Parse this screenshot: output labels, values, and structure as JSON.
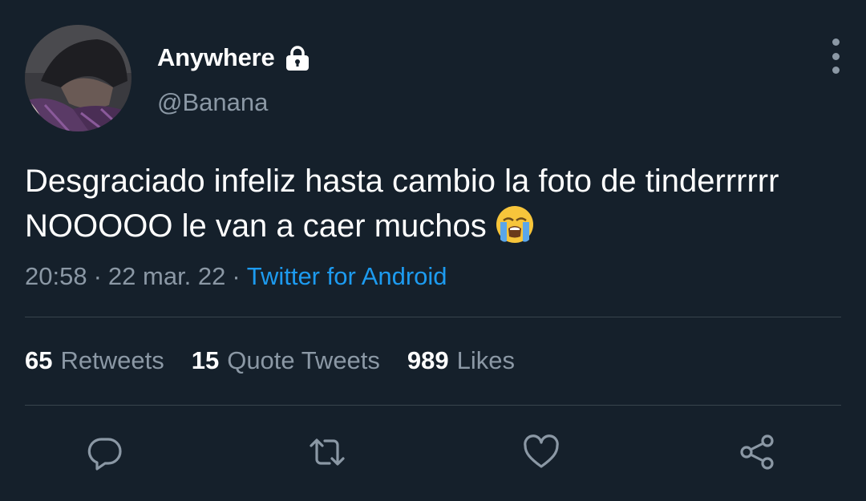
{
  "author": {
    "display_name": "Anywhere",
    "handle": "@Banana",
    "protected_icon": "lock-icon",
    "avatar": "profile-photo"
  },
  "tweet": {
    "text": "Desgraciado infeliz hasta cambio la foto de tinderrrrrr NOOOOO le van a caer muchos",
    "emoji": "loudly-crying-face",
    "time": "20:58",
    "date": "22 mar. 22",
    "separator": "·",
    "source": "Twitter for Android"
  },
  "stats": [
    {
      "count": "65",
      "label": "Retweets"
    },
    {
      "count": "15",
      "label": "Quote Tweets"
    },
    {
      "count": "989",
      "label": "Likes"
    }
  ],
  "actions": [
    "reply-icon",
    "retweet-icon",
    "like-icon",
    "share-icon"
  ],
  "colors": {
    "background": "#15202b",
    "text_primary": "#ffffff",
    "text_secondary": "#8b98a5",
    "link": "#1d9bf0",
    "divider": "#38444d"
  }
}
